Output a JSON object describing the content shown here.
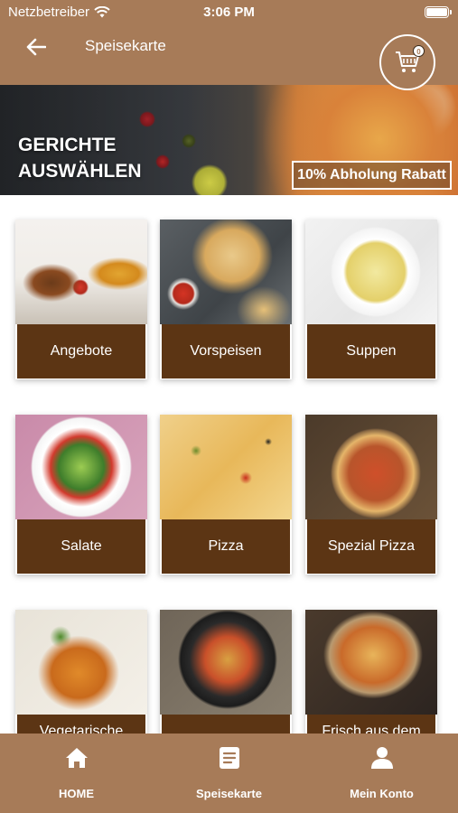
{
  "status_bar": {
    "carrier": "Netzbetreiber",
    "time": "3:06 PM"
  },
  "header": {
    "title": "Speisekarte",
    "cart_count": "0"
  },
  "banner": {
    "title": "GERICHTE AUSWÄHLEN",
    "promo": "10% Abholung Rabatt"
  },
  "categories": [
    {
      "label": "Angebote"
    },
    {
      "label": "Vorspeisen"
    },
    {
      "label": "Suppen"
    },
    {
      "label": "Salate"
    },
    {
      "label": "Pizza"
    },
    {
      "label": "Spezial Pizza"
    },
    {
      "label": "Vegetarische"
    },
    {
      "label": ""
    },
    {
      "label": "Frisch aus dem"
    }
  ],
  "tabbar": {
    "items": [
      {
        "label": "HOME",
        "icon": "home-icon"
      },
      {
        "label": "Speisekarte",
        "icon": "menu-list-icon"
      },
      {
        "label": "Mein Konto",
        "icon": "user-icon"
      }
    ]
  }
}
